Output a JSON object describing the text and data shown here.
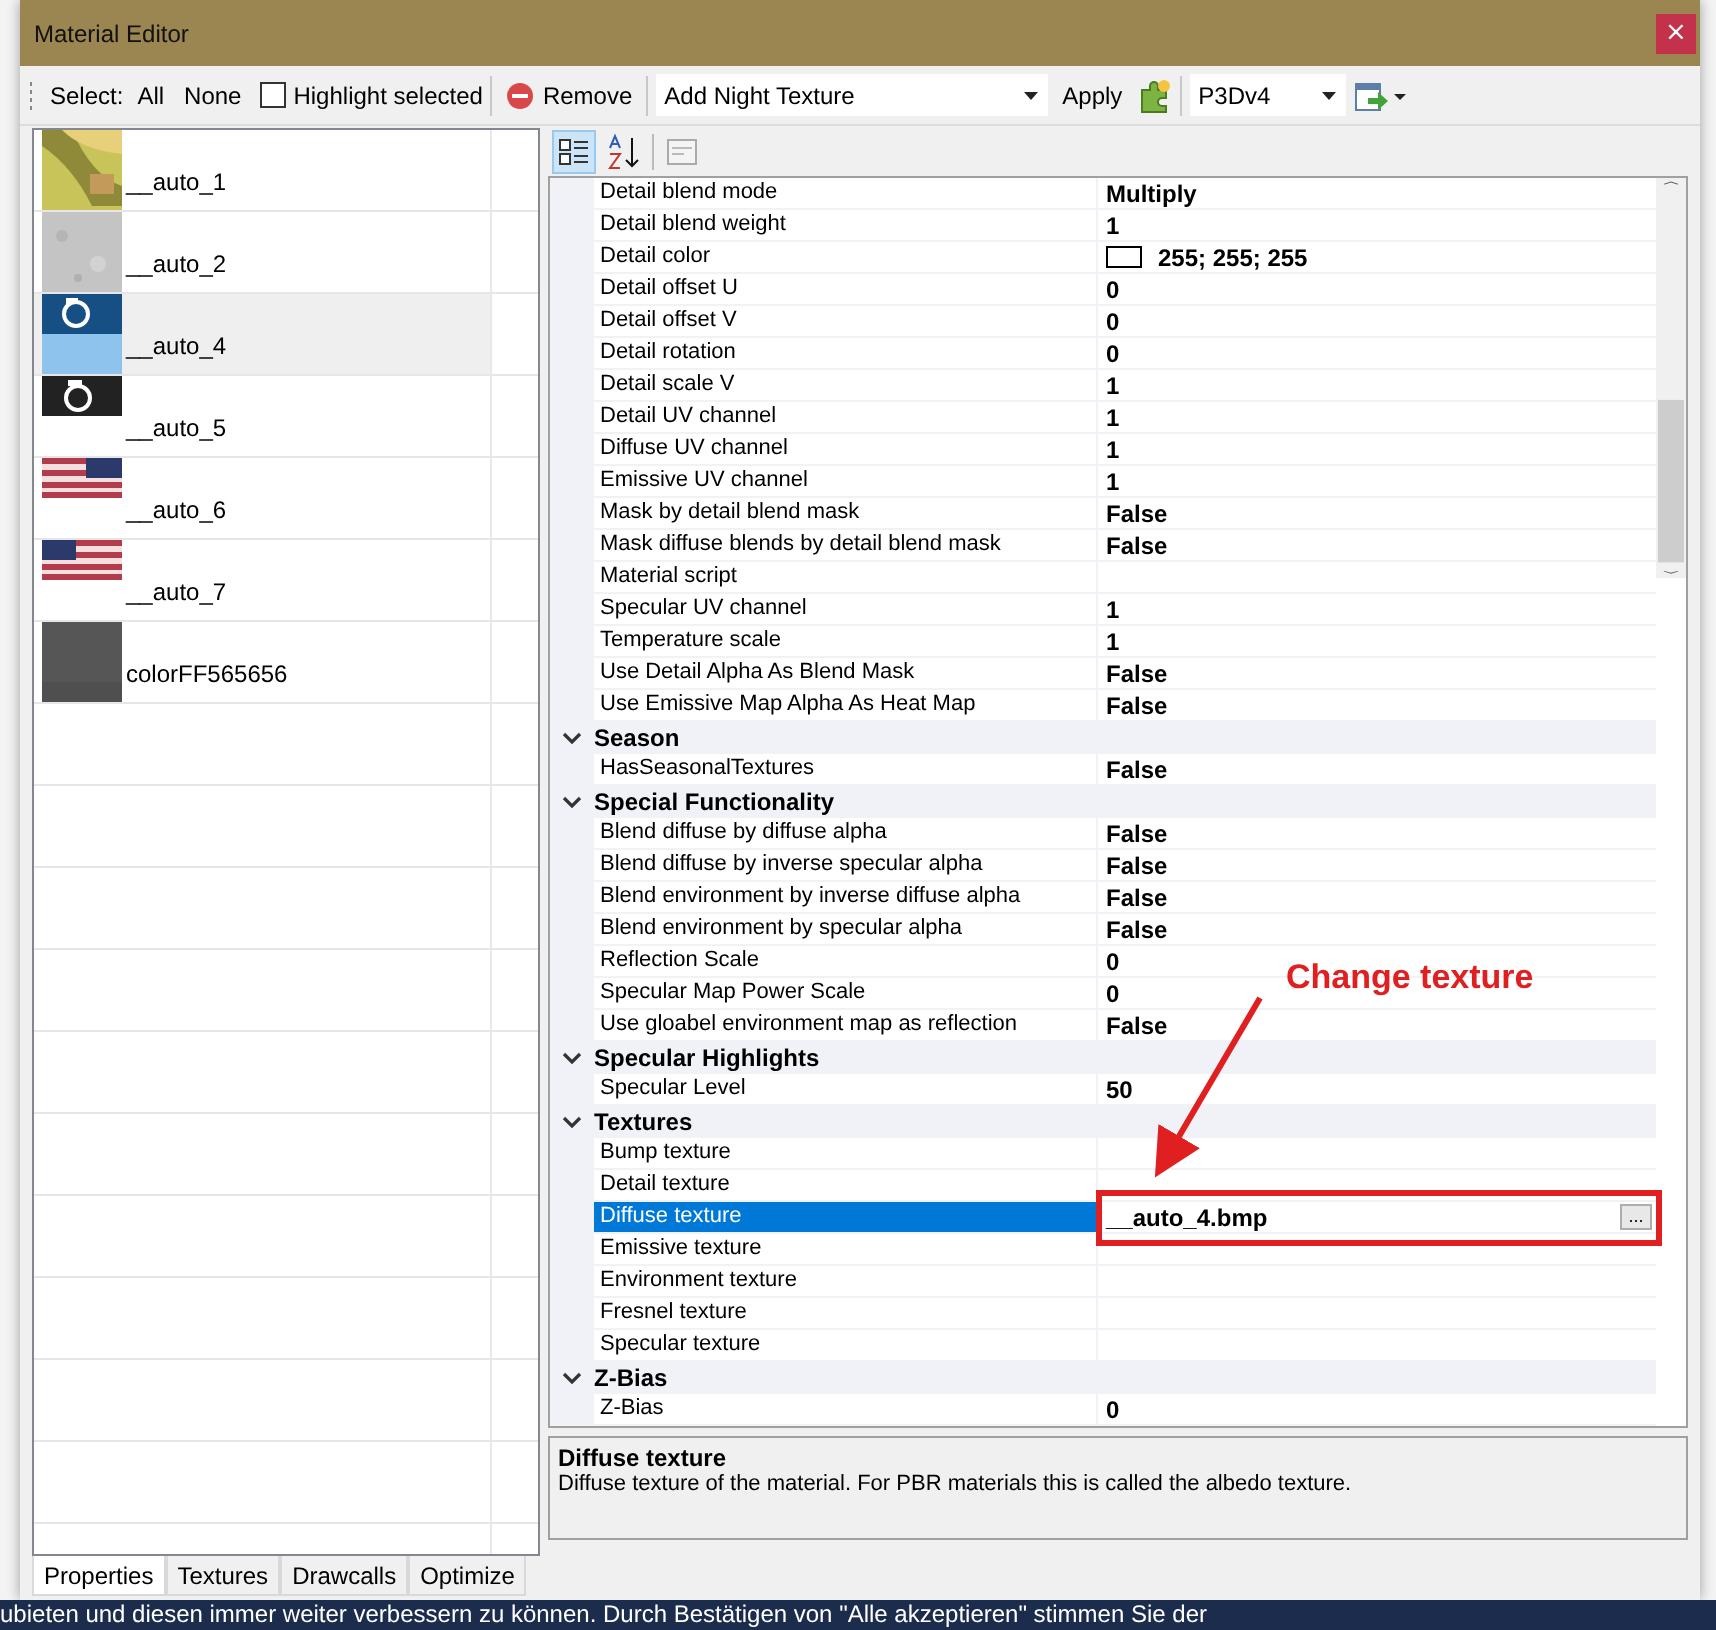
{
  "window": {
    "title": "Material Editor",
    "close": "×"
  },
  "toolbar": {
    "select_label": "Select:",
    "buttons": [
      "All",
      "None"
    ],
    "highlight": {
      "label": "Highlight selected",
      "checked": false
    },
    "remove": "Remove",
    "texture_dropdown": "Add Night Texture",
    "apply": "Apply",
    "platform_dropdown": "P3Dv4"
  },
  "materials": [
    {
      "name": "__auto_1",
      "selected": false
    },
    {
      "name": "__auto_2",
      "selected": false
    },
    {
      "name": "__auto_4",
      "selected": true
    },
    {
      "name": "__auto_5",
      "selected": false
    },
    {
      "name": "__auto_6",
      "selected": false
    },
    {
      "name": "__auto_7",
      "selected": false
    },
    {
      "name": "colorFF565656",
      "selected": false
    }
  ],
  "grid_toolbar": {
    "categorized": {
      "selected": true
    },
    "alphabetical": {
      "selected": false
    },
    "property_pages": {
      "disabled": true
    }
  },
  "property_groups": [
    {
      "rows": [
        {
          "name": "Detail blend mode",
          "value": "Multiply",
          "selected": false
        },
        {
          "name": "Detail blend weight",
          "value": "1",
          "selected": false
        },
        {
          "name": "Detail color",
          "value": "255; 255; 255",
          "color": "#ffffff",
          "selected": false
        },
        {
          "name": "Detail offset U",
          "value": "0",
          "selected": false
        },
        {
          "name": "Detail offset V",
          "value": "0",
          "selected": false
        },
        {
          "name": "Detail rotation",
          "value": "0",
          "selected": false
        },
        {
          "name": "Detail scale V",
          "value": "1",
          "selected": false
        },
        {
          "name": "Detail UV channel",
          "value": "1",
          "selected": false
        },
        {
          "name": "Diffuse UV channel",
          "value": "1",
          "selected": false
        },
        {
          "name": "Emissive UV channel",
          "value": "1",
          "selected": false
        },
        {
          "name": "Mask by detail blend mask",
          "value": "False",
          "selected": false
        },
        {
          "name": "Mask diffuse blends by detail blend mask",
          "value": "False",
          "selected": false
        },
        {
          "name": "Material script",
          "selected": false
        },
        {
          "name": "Specular UV channel",
          "value": "1",
          "selected": false
        },
        {
          "name": "Temperature scale",
          "value": "1",
          "selected": false
        },
        {
          "name": "Use Detail Alpha As Blend Mask",
          "value": "False",
          "selected": false
        },
        {
          "name": "Use Emissive Map Alpha As Heat Map",
          "value": "False",
          "selected": false
        }
      ]
    },
    {
      "title": "Season",
      "expanded": true,
      "rows": [
        {
          "name": "HasSeasonalTextures",
          "value": "False",
          "selected": false
        }
      ]
    },
    {
      "title": "Special Functionality",
      "expanded": true,
      "rows": [
        {
          "name": "Blend diffuse by diffuse alpha",
          "value": "False",
          "selected": false
        },
        {
          "name": "Blend diffuse by inverse specular alpha",
          "value": "False",
          "selected": false
        },
        {
          "name": "Blend environment by inverse diffuse alpha",
          "value": "False",
          "selected": false
        },
        {
          "name": "Blend environment by specular alpha",
          "value": "False",
          "selected": false
        },
        {
          "name": "Reflection Scale",
          "value": "0",
          "selected": false
        },
        {
          "name": "Specular Map Power Scale",
          "value": "0",
          "selected": false
        },
        {
          "name": "Use gloabel environment map as reflection",
          "value": "False",
          "selected": false
        }
      ]
    },
    {
      "title": "Specular Highlights",
      "expanded": true,
      "rows": [
        {
          "name": "Specular Level",
          "value": "50",
          "selected": false
        }
      ]
    },
    {
      "title": "Textures",
      "expanded": true,
      "rows": [
        {
          "name": "Bump texture",
          "selected": false
        },
        {
          "name": "Detail texture",
          "selected": false
        },
        {
          "name": "Diffuse texture",
          "value": "__auto_4.bmp",
          "selected": true,
          "button": "...",
          "annotation": "Change texture"
        },
        {
          "name": "Emissive texture",
          "selected": false
        },
        {
          "name": "Environment texture",
          "selected": false
        },
        {
          "name": "Fresnel texture",
          "selected": false
        },
        {
          "name": "Specular texture",
          "selected": false
        }
      ]
    },
    {
      "title": "Z-Bias",
      "expanded": true,
      "rows": [
        {
          "name": "Z-Bias",
          "value": "0",
          "selected": false
        }
      ]
    }
  ],
  "description": {
    "title": "Diffuse texture",
    "text": "Diffuse texture of the material. For PBR materials this is called the albedo texture."
  },
  "tabs": [
    {
      "label": "Properties",
      "selected": true
    },
    {
      "label": "Textures",
      "selected": false
    },
    {
      "label": "Drawcalls",
      "selected": false
    },
    {
      "label": "Optimize",
      "selected": false
    }
  ],
  "background_page": {
    "text": "ubieten und diesen immer weiter verbessern zu können. Durch Bestätigen von \"Alle akzeptieren\" stimmen Sie der"
  }
}
